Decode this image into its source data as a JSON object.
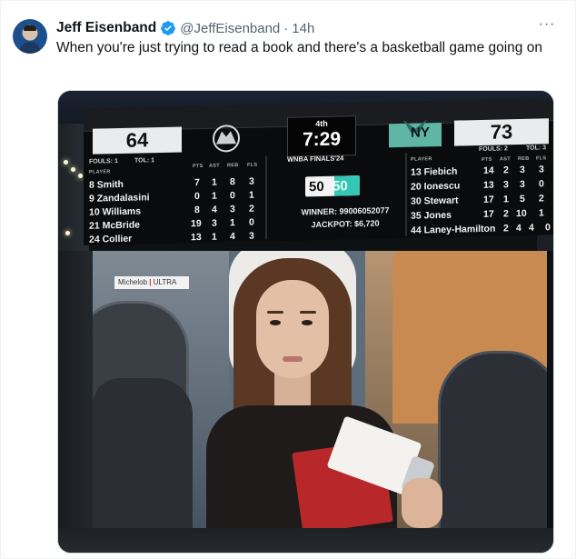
{
  "tweet": {
    "display_name": "Jeff Eisenband",
    "handle": "@JeffEisenband",
    "separator": "·",
    "time": "14h",
    "text": "When you're just trying to read a book and there's a basketball game going on",
    "more_icon": "···"
  },
  "scoreboard": {
    "left": {
      "score": "64",
      "fouls": "FOULS: 1",
      "tol": "TOL: 1",
      "players": [
        {
          "name": "8 Smith",
          "pts": "7",
          "ast": "1",
          "reb": "8",
          "fls": "3"
        },
        {
          "name": "9 Zandalasini",
          "pts": "0",
          "ast": "1",
          "reb": "0",
          "fls": "1"
        },
        {
          "name": "10 Williams",
          "pts": "8",
          "ast": "4",
          "reb": "3",
          "fls": "2"
        },
        {
          "name": "21 McBride",
          "pts": "19",
          "ast": "3",
          "reb": "1",
          "fls": "0"
        },
        {
          "name": "24 Collier",
          "pts": "13",
          "ast": "1",
          "reb": "4",
          "fls": "3"
        }
      ]
    },
    "right": {
      "score": "73",
      "fouls": "FOULS: 2",
      "tol": "TOL: 3",
      "logo_text": "NY",
      "players": [
        {
          "name": "13 Fiebich",
          "pts": "14",
          "ast": "2",
          "reb": "3",
          "fls": "3"
        },
        {
          "name": "20 Ionescu",
          "pts": "13",
          "ast": "3",
          "reb": "3",
          "fls": "0"
        },
        {
          "name": "30 Stewart",
          "pts": "17",
          "ast": "1",
          "reb": "5",
          "fls": "2"
        },
        {
          "name": "35 Jones",
          "pts": "17",
          "ast": "2",
          "reb": "10",
          "fls": "1"
        },
        {
          "name": "44 Laney-Hamilton",
          "pts": "2",
          "ast": "4",
          "reb": "4",
          "fls": "0"
        }
      ]
    },
    "columns": {
      "player": "PLAYER",
      "pts": "PTS",
      "ast": "AST",
      "reb": "REB",
      "fls": "FLS"
    },
    "quarter": "4th",
    "clock": "7:29",
    "finals_label": "WNBA FINALS'24",
    "fifty_left": "50",
    "fifty_right": "50",
    "winner": "WINNER: 99006052077",
    "jackpot": "JACKPOT: $6,720"
  },
  "video": {
    "sponsor_text_1": "Michelob",
    "sponsor_text_2": "ULTRA"
  },
  "colors": {
    "verified": "#1d9bf0",
    "text": "#0f1419",
    "secondary": "#536471"
  }
}
